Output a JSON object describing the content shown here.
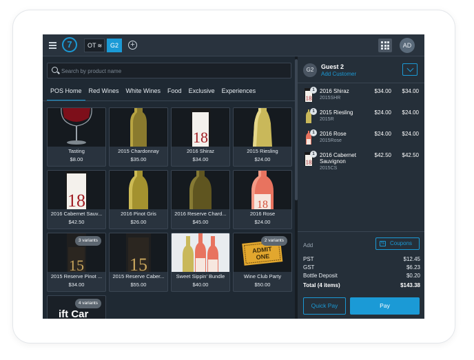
{
  "topbar": {
    "logo_text": "7",
    "tabs": [
      {
        "label": "OT",
        "active": false
      },
      {
        "label": "G2",
        "active": true
      }
    ],
    "avatar_initials": "AD"
  },
  "search": {
    "placeholder": "Search by product name"
  },
  "categories": [
    "POS Home",
    "Red Wines",
    "White Wines",
    "Food",
    "Exclusive",
    "Experiences"
  ],
  "products": [
    {
      "name": "Tasting",
      "price": "$8.00",
      "image": "red-wine-glass-icon"
    },
    {
      "name": "2015 Chardonnay",
      "price": "$35.00",
      "image": "white-wine-bottle-icon"
    },
    {
      "name": "2016 Shiraz",
      "price": "$34.00",
      "image": "red-wine-bottle-icon"
    },
    {
      "name": "2015 Riesling",
      "price": "$24.00",
      "image": "white-wine-bottle-icon"
    },
    {
      "name": "2016 Cabernet Sauv...",
      "price": "$42.50",
      "image": "red-wine-bottle-icon"
    },
    {
      "name": "2016 Pinot Gris",
      "price": "$26.00",
      "image": "white-wine-bottle-icon"
    },
    {
      "name": "2016 Reserve Chard...",
      "price": "$45.00",
      "image": "white-wine-bottle-icon"
    },
    {
      "name": "2016 Rose",
      "price": "$24.00",
      "image": "rose-wine-bottle-icon"
    },
    {
      "name": "2015 Reserve Pinot ...",
      "price": "$34.00",
      "image": "red-wine-bottle-icon",
      "badge": "3 variants"
    },
    {
      "name": "2015 Reserve Caber...",
      "price": "$55.00",
      "image": "red-wine-bottle-icon"
    },
    {
      "name": "Sweet Sippin' Bundle",
      "price": "$40.00",
      "image": "wine-bundle-icon"
    },
    {
      "name": "Wine Club Party",
      "price": "$50.00",
      "image": "admit-one-ticket-icon",
      "badge": "2 variants",
      "ticket_text": "ADMIT ONE"
    },
    {
      "name": "",
      "price": "",
      "image": "gift-card-icon",
      "badge": "4 variants",
      "card_text": "ift Car"
    }
  ],
  "cart": {
    "guest_initials": "G2",
    "guest_name": "Guest 2",
    "add_customer": "Add Customer",
    "items": [
      {
        "qty": "1",
        "name": "2016 Shiraz",
        "sku": "2015SHR",
        "unit": "$34.00",
        "total": "$34.00"
      },
      {
        "qty": "1",
        "name": "2015 Riesling",
        "sku": "2015R",
        "unit": "$24.00",
        "total": "$24.00"
      },
      {
        "qty": "1",
        "name": "2016 Rose",
        "sku": "2015Rose",
        "unit": "$24.00",
        "total": "$24.00"
      },
      {
        "qty": "1",
        "name": "2016 Cabernet Sauvignon",
        "sku": "2015CS",
        "unit": "$42.50",
        "total": "$42.50"
      }
    ],
    "add_label": "Add",
    "coupons_label": "Coupons",
    "summary": [
      {
        "label": "PST",
        "value": "$12.45"
      },
      {
        "label": "GST",
        "value": "$6.23"
      },
      {
        "label": "Bottle Deposit",
        "value": "$0.20"
      },
      {
        "label": "Total (4 items)",
        "value": "$143.38"
      }
    ],
    "quick_pay": "Quick Pay",
    "pay": "Pay"
  },
  "colors": {
    "accent": "#1b9ad6",
    "background": "#1f2933",
    "panel": "#252f39",
    "card": "#29333e"
  }
}
